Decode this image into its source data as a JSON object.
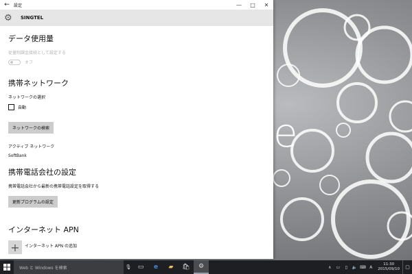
{
  "window": {
    "title": "設定",
    "header_title": "SINGTEL",
    "back_icon": "back-arrow-icon",
    "header_icon": "gear-icon",
    "controls": [
      "—",
      "□",
      "✕"
    ]
  },
  "sections": {
    "data_usage": {
      "title": "データ使用量",
      "metered_label": "従量制課金接続として設定する",
      "toggle_state": "オフ"
    },
    "mobile_network": {
      "title": "携帯ネットワーク",
      "select_label": "ネットワークの選択",
      "auto_label": "自動",
      "search_button": "ネットワークの検索",
      "active_label": "アクティブ ネットワーク",
      "active_value": "SoftBank"
    },
    "carrier": {
      "title": "携帯電話会社の設定",
      "description": "携帯電話会社から最新の携帯電話設定を取得する",
      "update_button": "更新プログラムの設定"
    },
    "apn": {
      "title": "インターネット APN",
      "add_label": "インターネット APN の追加"
    }
  },
  "desktop": {
    "brand_letter": "e"
  },
  "taskbar": {
    "search_placeholder": "Web と Windows を検索",
    "time": "11:30",
    "date": "2015/09/10"
  },
  "colors": {
    "taskbar": "#1d1f22",
    "header": "#e6e6e6",
    "button": "#cccccc"
  }
}
